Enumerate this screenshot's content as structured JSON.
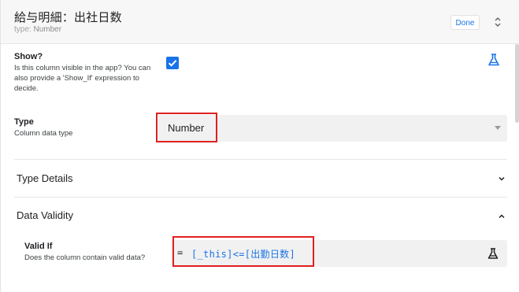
{
  "header": {
    "title": "給与明細：出社日数",
    "type_label": "type: ",
    "type_value": "Number",
    "done_label": "Done"
  },
  "show": {
    "label": "Show?",
    "description": "Is this column visible in the app? You can also provide a 'Show_If' expression to decide.",
    "checked": true
  },
  "type": {
    "label": "Type",
    "description": "Column data type",
    "selected": "Number"
  },
  "sections": {
    "type_details": "Type Details",
    "data_validity": "Data Validity"
  },
  "valid_if": {
    "label": "Valid If",
    "description": "Does the column contain valid data?",
    "equals": "=",
    "expression": "[_this]<=[出勤日数]"
  },
  "colors": {
    "accent": "#1a73e8",
    "highlight": "#e02020"
  }
}
